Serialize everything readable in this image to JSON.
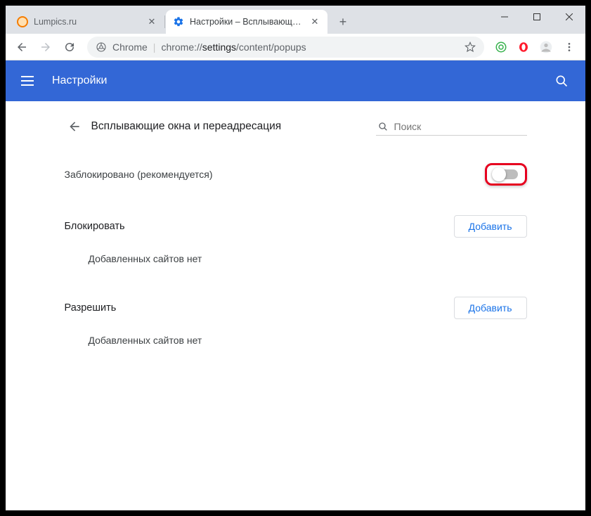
{
  "tabs": [
    {
      "title": "Lumpics.ru",
      "favicon": "lumpics"
    },
    {
      "title": "Настройки – Всплывающие окн",
      "favicon": "gear"
    }
  ],
  "omnibox": {
    "secure_label": "Chrome",
    "origin": "chrome://",
    "path_bold": "settings",
    "path_rest": "/content/popups"
  },
  "header": {
    "title": "Настройки"
  },
  "page": {
    "title": "Всплывающие окна и переадресация",
    "search_placeholder": "Поиск",
    "blocked_label": "Заблокировано (рекомендуется)",
    "toggle_on": false,
    "sections": [
      {
        "title": "Блокировать",
        "add_label": "Добавить",
        "empty": "Добавленных сайтов нет"
      },
      {
        "title": "Разрешить",
        "add_label": "Добавить",
        "empty": "Добавленных сайтов нет"
      }
    ]
  }
}
